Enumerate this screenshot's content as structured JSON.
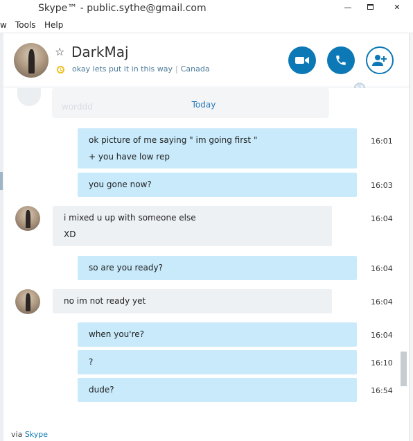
{
  "window": {
    "title": "Skype™ - public.sythe@gmail.com"
  },
  "menu": {
    "items": [
      "w",
      "Tools",
      "Help"
    ]
  },
  "contact": {
    "name": "DarkMaj",
    "mood": "okay lets put it in this way",
    "location": "Canada",
    "status": "away"
  },
  "icons": {
    "video": "video-call-icon",
    "call": "phone-icon",
    "add": "add-contact-icon",
    "favorite": "star-icon",
    "globe": "globe-icon"
  },
  "colors": {
    "accent": "#0c78b5",
    "outgoing_bubble": "#c8eafb",
    "incoming_bubble": "#eef1f4",
    "away": "#f0c020"
  },
  "chat": {
    "ghost_text": "worddd",
    "date_label": "Today",
    "messages": [
      {
        "dir": "out",
        "lines": [
          "ok picture of me saying \" im going first \"",
          "+ you have low rep"
        ],
        "time": "16:01"
      },
      {
        "dir": "out",
        "lines": [
          "you gone now?"
        ],
        "time": "16:03"
      },
      {
        "dir": "in",
        "lines": [
          "i mixed u up with someone else",
          "XD"
        ],
        "time": "16:04"
      },
      {
        "dir": "out",
        "lines": [
          "so are you ready?"
        ],
        "time": "16:04"
      },
      {
        "dir": "in",
        "lines": [
          "no im not ready yet"
        ],
        "time": "16:04"
      },
      {
        "dir": "out",
        "lines": [
          "when you're?"
        ],
        "time": "16:04"
      },
      {
        "dir": "out",
        "lines": [
          "?"
        ],
        "time": "16:10"
      },
      {
        "dir": "out",
        "lines": [
          "dude?"
        ],
        "time": "16:54"
      }
    ]
  },
  "footer": {
    "prefix": "via",
    "link": "Skype"
  }
}
